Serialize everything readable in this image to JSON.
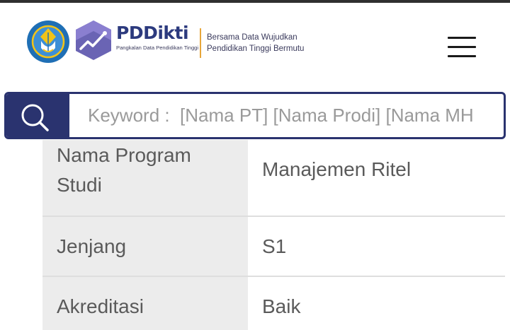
{
  "header": {
    "brand_title": "PDDikti",
    "brand_subtitle": "Pangkalan Data Pendidikan Tinggi",
    "tagline_line1": "Bersama Data Wujudkan",
    "tagline_line2": "Pendidikan Tinggi Bermutu",
    "logo_icon": "kemdikbud-logo-icon",
    "pddikti_icon": "pddikti-logo-icon",
    "menu_icon": "hamburger-menu-icon"
  },
  "search": {
    "placeholder": "Keyword :  [Nama PT] [Nama Prodi] [Nama MH",
    "value": "",
    "icon": "search-icon",
    "accent_color": "#2a336f"
  },
  "program_info": {
    "rows": [
      {
        "label": "Nama Program Studi",
        "value": "Manajemen Ritel"
      },
      {
        "label": "Jenjang",
        "value": "S1"
      },
      {
        "label": "Akreditasi",
        "value": "Baik"
      }
    ]
  },
  "colors": {
    "brand_navy": "#2c3a7e",
    "brand_purple": "#6a64b4",
    "divider_gold": "#e7a63a",
    "label_bg": "#ececec"
  }
}
